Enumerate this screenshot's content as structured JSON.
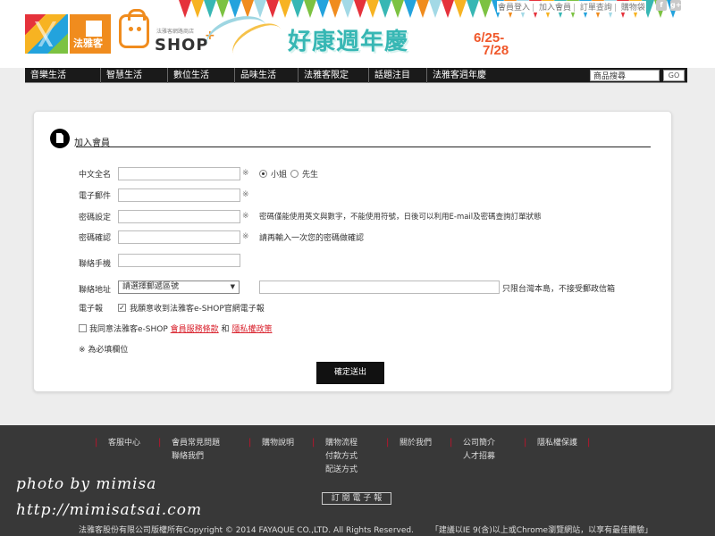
{
  "header": {
    "logo_label": "法雅客",
    "eshop_small": "法雅客網路商店",
    "eshop_text": "SHOP",
    "eshop_plus": "+",
    "banner_title": "好康週年慶",
    "banner_date_1": "6/25-",
    "banner_date_2": "7/28",
    "top_links": [
      "會員登入",
      "加入會員",
      "訂單查詢",
      "購物袋"
    ],
    "social": [
      "f",
      "g+"
    ]
  },
  "nav": {
    "items": [
      "音樂生活",
      "智慧生活",
      "數位生活",
      "品味生活",
      "法雅客限定",
      "話題注目",
      "法雅客週年慶"
    ],
    "search_placeholder": "商品搜尋",
    "go_label": "GO"
  },
  "form": {
    "section_title": "加入會員",
    "required_mark": "※",
    "fields": {
      "name_label": "中文全名",
      "email_label": "電子郵件",
      "password_label": "密碼設定",
      "password_confirm_label": "密碼確認",
      "mobile_label": "聯絡手機",
      "address_label": "聯絡地址",
      "epaper_label": "電子報"
    },
    "gender_options": [
      "小姐",
      "先生"
    ],
    "gender_selected": "小姐",
    "password_hint": "密碼僅能使用英文與數字，不能使用符號，日後可以利用E-mail及密碼查詢訂單狀態",
    "password_confirm_hint": "請再輸入一次您的密碼做確認",
    "zip_select": "請選擇郵遞區號",
    "address_hint": "只限台灣本島，不接受郵政信箱",
    "epaper_option": "我願意收到法雅客e-SHOP官網電子報",
    "epaper_checked": true,
    "agree_prefix": "我同意法雅客e-SHOP",
    "agree_link_terms": "會員服務條款",
    "agree_and": "和",
    "agree_link_privacy": "隱私權政策",
    "agree_checked": false,
    "required_note": "※ 為必填欄位",
    "submit_label": "確定送出"
  },
  "footer": {
    "columns": [
      [
        "客服中心"
      ],
      [
        "會員常見問題",
        "聯絡我們"
      ],
      [
        "購物說明"
      ],
      [
        "購物流程",
        "付款方式",
        "配送方式"
      ],
      [
        "關於我們"
      ],
      [
        "公司簡介",
        "人才招募"
      ],
      [
        "隱私權保護"
      ]
    ],
    "bar_char": "|",
    "subscribe_label": "訂 閱 電 子 報",
    "copyright": "法雅客股份有限公司版權所有Copyright © 2014 FAYAQUE CO.,LTD. All Rights Reserved.",
    "browser_note": "「建議以IE 9(含)以上或Chrome瀏覽網站，以享有最佳體驗」"
  },
  "watermark": {
    "line1": "photo by mimisa",
    "line2": "http://mimisatsai.com"
  },
  "colors": {
    "brand_orange": "#f08c1e",
    "nav_bg": "#1a1a1a",
    "footer_bg": "#383838",
    "link_red": "#d9232e",
    "anniv_teal": "#37b7b4"
  }
}
